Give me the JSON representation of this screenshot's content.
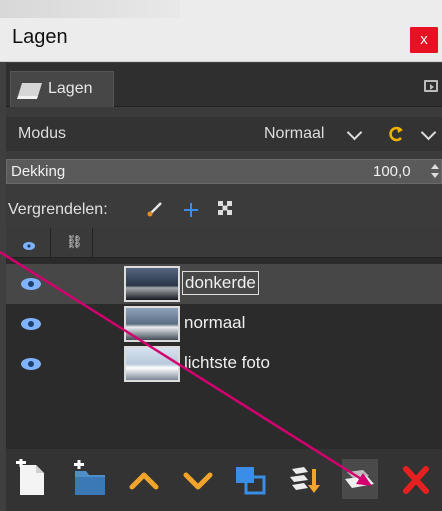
{
  "window": {
    "title": "Lagen",
    "close_label": "x"
  },
  "tab": {
    "label": "Lagen",
    "icon": "layers-icon"
  },
  "mode": {
    "label": "Modus",
    "value": "Normaal"
  },
  "opacity": {
    "label": "Dekking",
    "value": "100,0"
  },
  "lock": {
    "label": "Vergrendelen:"
  },
  "layers": [
    {
      "name": "donkerde",
      "visible": true,
      "selected": true
    },
    {
      "name": "normaal",
      "visible": true,
      "selected": false
    },
    {
      "name": "lichtste foto",
      "visible": true,
      "selected": false
    }
  ],
  "toolbar_icons": [
    "new-layer-icon",
    "new-layer-group-icon",
    "raise-layer-icon",
    "lower-layer-icon",
    "duplicate-layer-icon",
    "anchor-layer-icon",
    "merge-layer-icon",
    "delete-layer-icon"
  ],
  "colors": {
    "panel_bg": "#3b3b3b",
    "list_bg": "#2b2b2b",
    "selected_row": "#474747",
    "eye_blue": "#7fb3ff",
    "close_red": "#e81123",
    "annotation_arrow": "#d4006f"
  }
}
